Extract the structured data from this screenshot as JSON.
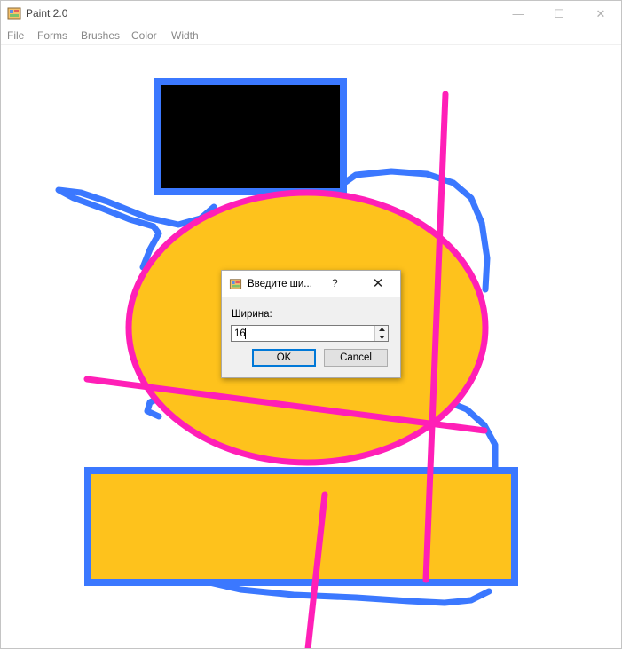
{
  "window": {
    "title": "Paint 2.0",
    "caption_buttons": {
      "minimize": "—",
      "maximize": "☐",
      "close": "✕"
    }
  },
  "menu": [
    "File",
    "Forms",
    "Brushes",
    "Color",
    "Width"
  ],
  "canvas": {
    "colors": {
      "blue": "#3b78ff",
      "magenta": "#ff1fb7",
      "orange": "#fec21c",
      "black": "#000000"
    }
  },
  "dialog": {
    "title": "Введите ши...",
    "help": "?",
    "close": "✕",
    "label": "Ширина:",
    "value": "16",
    "ok": "OK",
    "cancel": "Cancel"
  }
}
